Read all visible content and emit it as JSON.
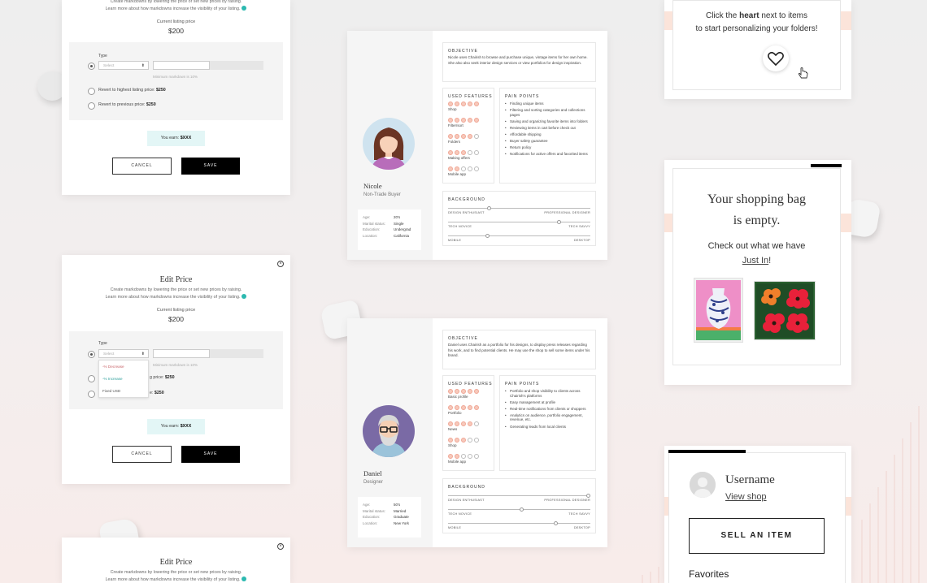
{
  "edit_price": {
    "title": "Edit Price",
    "desc_line1": "Create markdowns by lowering the price or set new prices by raising.",
    "desc_line2": "Learn more about how markdowns increase the visibility of your listing.",
    "current_label": "Current listing price",
    "current_value": "$200",
    "type_label": "Type",
    "select_placeholder": "Select",
    "hint": "Minimum markdown is 10%",
    "opt_highest_prefix": "Revert to highest listing price: ",
    "opt_highest_value": "$250",
    "opt_previous_prefix": "Revert to previous price: ",
    "opt_previous_value": "$250",
    "opt_highest_partial": "g price: ",
    "opt_previous_partial": "e: ",
    "earn_prefix": "You earn: ",
    "earn_value": "$XXX",
    "cancel": "CANCEL",
    "save": "SAVE",
    "close": "×",
    "dropdown": [
      "-% Decrease",
      "-% Increase",
      "Fixed USD"
    ]
  },
  "persona_nicole": {
    "name": "Nicole",
    "role": "Non-Trade Buyer",
    "info": [
      {
        "k": "Age:",
        "v": "20's"
      },
      {
        "k": "Marital status:",
        "v": "Single"
      },
      {
        "k": "Education:",
        "v": "Undergrad"
      },
      {
        "k": "Location:",
        "v": "California"
      }
    ],
    "objective_title": "OBJECTIVE",
    "objective": "Nicole uses Chairish to browse and purchase unique, vintage items for her own home. She also also seek interior design services or view portfolios for design inspiration.",
    "features_title": "USED FEATURES",
    "features": [
      "Shop",
      "Filter/sort",
      "Folders",
      "Making offers",
      "Mobile app"
    ],
    "pain_title": "PAIN POINTS",
    "pain": [
      "Finding unique items",
      "Filtering and sorting categories and collections pages",
      "Saving and organizing favorite items into folders",
      "Reviewing items in cart before check out",
      "Affordable shipping",
      "Buyer safety guarantee",
      "Return policy",
      "Notifications for active offers and favorited items"
    ],
    "background_title": "BACKGROUND",
    "bg": [
      {
        "l": "DESIGN ENTHUSIAST",
        "r": "PROFESSIONAL DESIGNER"
      },
      {
        "l": "TECH NOVICE",
        "r": "TECH SAVVY"
      },
      {
        "l": "MOBILE",
        "r": "DESKTOP"
      }
    ]
  },
  "persona_daniel": {
    "name": "Daniel",
    "role": "Designer",
    "info": [
      {
        "k": "Age:",
        "v": "50's"
      },
      {
        "k": "Marital status:",
        "v": "Married"
      },
      {
        "k": "Education:",
        "v": "Graduate"
      },
      {
        "k": "Location:",
        "v": "New York"
      }
    ],
    "objective_title": "OBJECTIVE",
    "objective": "Daniel uses Chairish as a portfolio for his designs, to display press releases regarding his work, and to find potential clients. He may use the shop to sell some items under his brand.",
    "features_title": "USED FEATURES",
    "features": [
      "Basic profile",
      "Portfolio",
      "News",
      "Shop",
      "Mobile app"
    ],
    "pain_title": "PAIN POINTS",
    "pain": [
      "Portfolio and shop visibility to clients across Chairish's platforms",
      "Easy management at profile",
      "Real-time notifications from clients or shoppers",
      "Analytics on audience, portfolio engagement, revenue, etc.",
      "Generating leads from local clients"
    ],
    "background_title": "BACKGROUND",
    "bg": [
      {
        "l": "DESIGN ENTHUSIAST",
        "r": "PROFESSIONAL DESIGNER"
      },
      {
        "l": "TECH NOVICE",
        "r": "TECH SAVVY"
      },
      {
        "l": "MOBILE",
        "r": "DESKTOP"
      }
    ]
  },
  "favorites_empty": {
    "line1_prefix": "Click the ",
    "line1_bold": "heart",
    "line1_suffix": " next to items",
    "line2": "to start personalizing your folders!"
  },
  "bag_empty": {
    "title_line1": "Your shopping bag",
    "title_line2": "is empty.",
    "check_out": "Check out what we have",
    "just_in": "Just In",
    "bang": "!"
  },
  "user_menu": {
    "username": "Username",
    "view_shop": "View shop",
    "sell": "SELL AN ITEM",
    "favorites": "Favorites"
  },
  "colors": {
    "accent_teal": "#2cb9b0",
    "earn_bg": "#e3f6f6",
    "pink_band": "#fbe4da",
    "dot_fill": "#f7c9bb"
  },
  "feature_levels": {
    "nicole": [
      5,
      5,
      4,
      3,
      2
    ],
    "daniel": [
      5,
      5,
      4,
      3,
      2
    ]
  }
}
